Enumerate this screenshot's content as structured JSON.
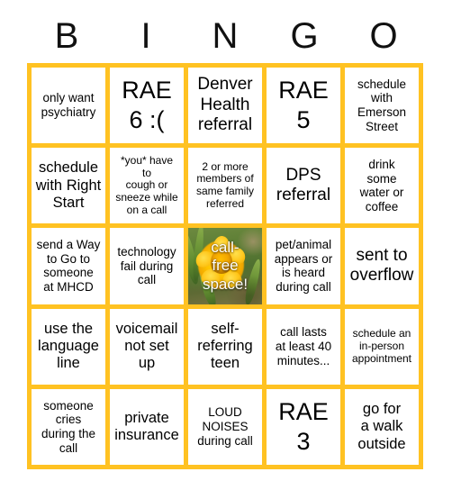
{
  "card": {
    "title": "BINGO",
    "border_color": "#FFC222",
    "header_letters": [
      "B",
      "I",
      "N",
      "G",
      "O"
    ],
    "columns": 5,
    "rows": 5,
    "cells": [
      {
        "text": "only want\npsychiatry",
        "size": "sm",
        "type": "text"
      },
      {
        "text": "RAE\n6 :(",
        "size": "xl",
        "type": "text"
      },
      {
        "text": "Denver\nHealth\nreferral",
        "size": "lg",
        "type": "text"
      },
      {
        "text": "RAE\n5",
        "size": "xl",
        "type": "text"
      },
      {
        "text": "schedule\nwith\nEmerson\nStreet",
        "size": "sm",
        "type": "text"
      },
      {
        "text": "schedule\nwith Right\nStart",
        "size": "md",
        "type": "text"
      },
      {
        "text": "*you* have\nto\ncough or\nsneeze while\non a call",
        "size": "xs",
        "type": "text"
      },
      {
        "text": "2 or more\nmembers of\nsame family\nreferred",
        "size": "xs",
        "type": "text"
      },
      {
        "text": "DPS\nreferral",
        "size": "lg",
        "type": "text"
      },
      {
        "text": "drink\nsome\nwater or\ncoffee",
        "size": "sm",
        "type": "text"
      },
      {
        "text": "send a Way\nto Go to\nsomeone\nat MHCD",
        "size": "sm",
        "type": "text"
      },
      {
        "text": "technology\nfail during\ncall",
        "size": "sm",
        "type": "text"
      },
      {
        "text": "call-\nfree\nspace!",
        "size": "md",
        "type": "free-space"
      },
      {
        "text": "pet/animal\nappears or\nis heard\nduring call",
        "size": "sm",
        "type": "text"
      },
      {
        "text": "sent to\noverflow",
        "size": "lg",
        "type": "text"
      },
      {
        "text": "use the\nlanguage\nline",
        "size": "md",
        "type": "text"
      },
      {
        "text": "voicemail\nnot set\nup",
        "size": "md",
        "type": "text"
      },
      {
        "text": "self-\nreferring\nteen",
        "size": "md",
        "type": "text"
      },
      {
        "text": "call lasts\nat least 40\nminutes...",
        "size": "sm",
        "type": "text"
      },
      {
        "text": "schedule an\nin-person\nappointment",
        "size": "xs",
        "type": "text"
      },
      {
        "text": "someone\ncries\nduring the\ncall",
        "size": "sm",
        "type": "text"
      },
      {
        "text": "private\ninsurance",
        "size": "md",
        "type": "text"
      },
      {
        "text": "LOUD\nNOISES\nduring call",
        "size": "sm",
        "type": "text"
      },
      {
        "text": "RAE\n3",
        "size": "xl",
        "type": "text"
      },
      {
        "text": "go for\na walk\noutside",
        "size": "md",
        "type": "text"
      }
    ]
  }
}
